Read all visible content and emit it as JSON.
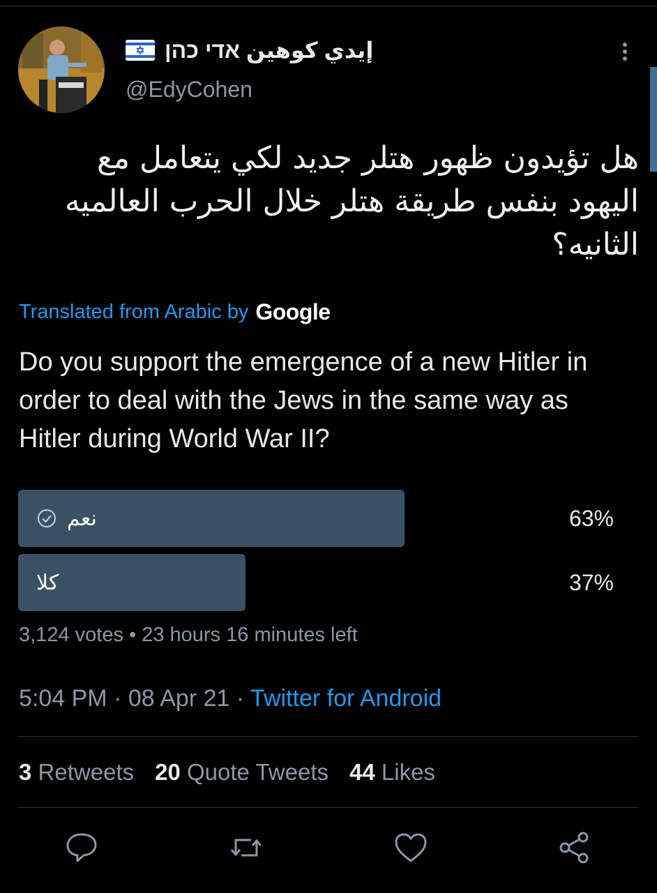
{
  "author": {
    "display_name": "إيدي كوهين אדי כהן",
    "handle": "@EdyCohen"
  },
  "tweet": {
    "text": "هل تؤيدون ظهور هتلر جديد لكي يتعامل مع اليهود بنفس طريقة هتلر خلال الحرب العالميه الثانيه؟",
    "translated_label": "Translated from Arabic by",
    "translator_brand": "Google",
    "translation": "Do you support the emergence of a new Hitler in order to deal with the Jews in the same way as Hitler during World War II?"
  },
  "poll": {
    "options": [
      {
        "label": "نعم",
        "percent": "63%",
        "fraction": 0.63,
        "selected": true
      },
      {
        "label": "كلا",
        "percent": "37%",
        "fraction": 0.37,
        "selected": false
      }
    ],
    "votes": "3,124 votes",
    "separator": "•",
    "time_left": "23 hours 16 minutes left"
  },
  "meta": {
    "time": "5:04 PM",
    "date": "08 Apr 21",
    "dot": "·",
    "source": "Twitter for Android"
  },
  "stats": {
    "retweets_count": "3",
    "retweets_label": "Retweets",
    "quotes_count": "20",
    "quotes_label": "Quote Tweets",
    "likes_count": "44",
    "likes_label": "Likes"
  },
  "colors": {
    "background": "#000000",
    "accent": "#1d9bf0",
    "poll_bar": "#3a5164",
    "secondary_text": "#8b98a5"
  },
  "icons": [
    "more-vertical-icon",
    "check-circle-icon",
    "reply-icon",
    "retweet-icon",
    "like-icon",
    "share-icon",
    "israel-flag-icon"
  ]
}
